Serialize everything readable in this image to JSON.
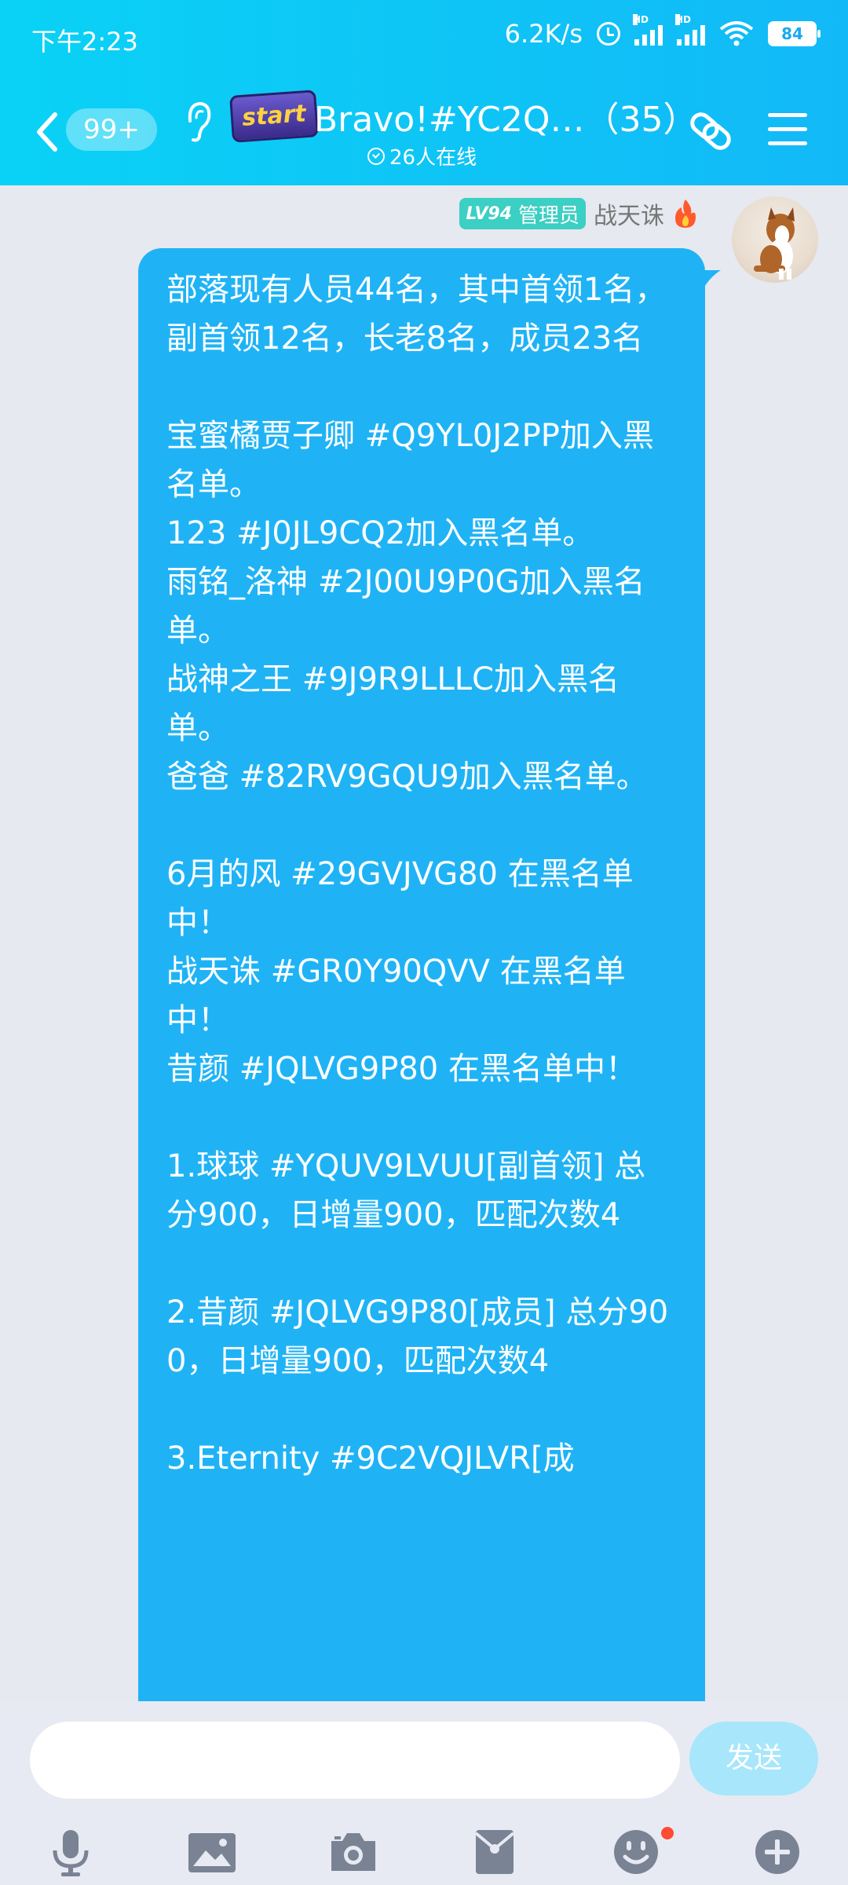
{
  "status": {
    "time": "下午2:23",
    "net_speed": "6.2K/s",
    "signal_label": "HD",
    "battery": "84"
  },
  "header": {
    "unread_count": "99+",
    "logo_text": "start",
    "title": "Bravo!#YC2Q…（35）",
    "online": "26人在线"
  },
  "message": {
    "level": "LV94",
    "role": "管理员",
    "sender": "战天诛",
    "lines": [
      "部落现有人员44名，其中首领1名，副首领12名，长老8名，成员23名",
      "",
      "宝蜜橘贾子卿 #Q9YL0J2PP加入黑名单。",
      "123 #J0JL9CQ2加入黑名单。",
      "雨铭_洛神 #2J00U9P0G加入黑名单。",
      "战神之王 #9J9R9LLLC加入黑名单。",
      "爸爸 #82RV9GQU9加入黑名单。",
      "",
      "6月的风 #29GVJVG80 在黑名单中！",
      "战天诛 #GR0Y90QVV 在黑名单中！",
      "昔颜 #JQLVG9P80 在黑名单中！",
      "",
      "1.球球 #YQUV9LVUU[副首领] 总分900，日增量900，匹配次数4",
      "",
      "2.昔颜 #JQLVG9P80[成员] 总分900，日增量900，匹配次数4",
      "",
      "3.Eternity #9C2VQJLVR[成"
    ]
  },
  "input": {
    "placeholder": "",
    "send_label": "发送"
  },
  "toolbar": {
    "icons": [
      "microphone-icon",
      "image-icon",
      "camera-icon",
      "red-packet-icon",
      "emoji-icon",
      "plus-icon"
    ]
  }
}
